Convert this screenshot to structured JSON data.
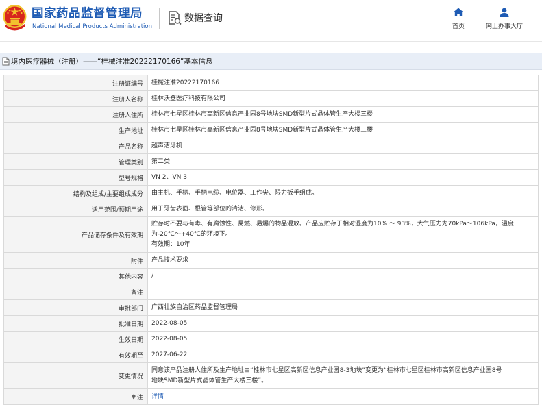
{
  "header": {
    "agency_name_cn": "国家药品监督管理局",
    "agency_name_en": "National Medical Products Administration",
    "query_label": "数据查询",
    "nav": [
      {
        "label": "首页",
        "icon": "home-icon"
      },
      {
        "label": "网上办事大厅",
        "icon": "user-icon"
      }
    ]
  },
  "title_bar": {
    "text": "境内医疗器械（注册）——“桂械注准20222170166”基本信息"
  },
  "fields": [
    {
      "key": "注册证编号",
      "value": "桂械注准20222170166"
    },
    {
      "key": "注册人名称",
      "value": "桂林沃登医疗科技有限公司"
    },
    {
      "key": "注册人住所",
      "value": "桂林市七星区桂林市高新区信息产业园8号地块SMD新型片式晶体管生产大楼三楼"
    },
    {
      "key": "生产地址",
      "value": "桂林市七星区桂林市高新区信息产业园8号地块SMD新型片式晶体管生产大楼三楼"
    },
    {
      "key": "产品名称",
      "value": "超声洁牙机"
    },
    {
      "key": "管理类别",
      "value": "第二类"
    },
    {
      "key": "型号规格",
      "value": "VN 2、VN 3"
    },
    {
      "key": "结构及组成/主要组成成分",
      "value": "由主机、手柄、手柄电缆、电位器、工作尖、限力扳手组成。"
    },
    {
      "key": "适用范围/预期用途",
      "value": "用于牙齿表面、根管等部位的清洁、修形。"
    },
    {
      "key": "产品储存条件及有效期",
      "value_lines": [
        "贮存时不要与有毒、有腐蚀性、易燃、易爆的物品混放。产品应贮存于相对湿度为10% ～ 93%，大气压力为70kPa～106kPa，温度",
        "为-20℃～+40℃的环境下。",
        "有效期：10年"
      ]
    },
    {
      "key": "附件",
      "value": "产品技术要求"
    },
    {
      "key": "其他内容",
      "value": "/"
    },
    {
      "key": "备注",
      "value": ""
    },
    {
      "key": "审批部门",
      "value": "广西壮族自治区药品监督管理局"
    },
    {
      "key": "批准日期",
      "value": "2022-08-05"
    },
    {
      "key": "生效日期",
      "value": "2022-08-05"
    },
    {
      "key": "有效期至",
      "value": "2027-06-22"
    },
    {
      "key": "变更情况",
      "value_lines": [
        "同意该产品注册人住所及生产地址由“桂林市七星区高新区信息产业园8-3地块”变更为“桂林市七星区桂林市高新区信息产业园8号",
        "地块SMD新型片式晶体管生产大楼三楼”。"
      ]
    },
    {
      "key": "注",
      "value": "详情",
      "is_link": true
    }
  ],
  "colors": {
    "brand_blue": "#1e5bb4",
    "emblem_red": "#d7261e",
    "emblem_gold": "#f2c12e",
    "title_bar_bg": "#e8eef7",
    "label_bg": "#f4f4f4"
  }
}
